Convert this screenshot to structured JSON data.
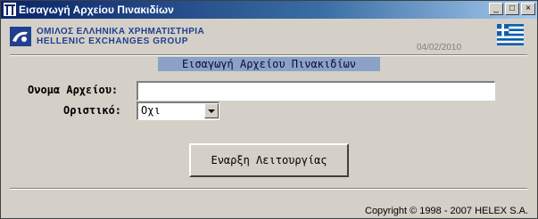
{
  "window": {
    "title": "Εισαγωγή Αρχείου Πινακιδίων",
    "minimize": "_",
    "maximize": "□",
    "close": "×"
  },
  "brand": {
    "line1": "ΟΜΙΛΟΣ ΕΛΛΗΝΙΚΑ ΧΡΗΜΑΤΙΣΤΗΡΙΑ",
    "line2": "HELLENIC EXCHANGES GROUP"
  },
  "date": "04/02/2010",
  "section_title": "Εισαγωγή Αρχείου Πινακιδίων",
  "form": {
    "file_label": "Ονομα Αρχείου:",
    "file_value": "",
    "final_label": "Οριστικό:",
    "final_value": "Οχι"
  },
  "start_button": "Εναρξη Λειτουργίας",
  "copyright": "Copyright © 1998 - 2007 HELEX S.A.",
  "colors": {
    "title_bar": "#0a246a",
    "section_bg": "#8ba2c6",
    "brand_blue": "#1f3f8f"
  }
}
